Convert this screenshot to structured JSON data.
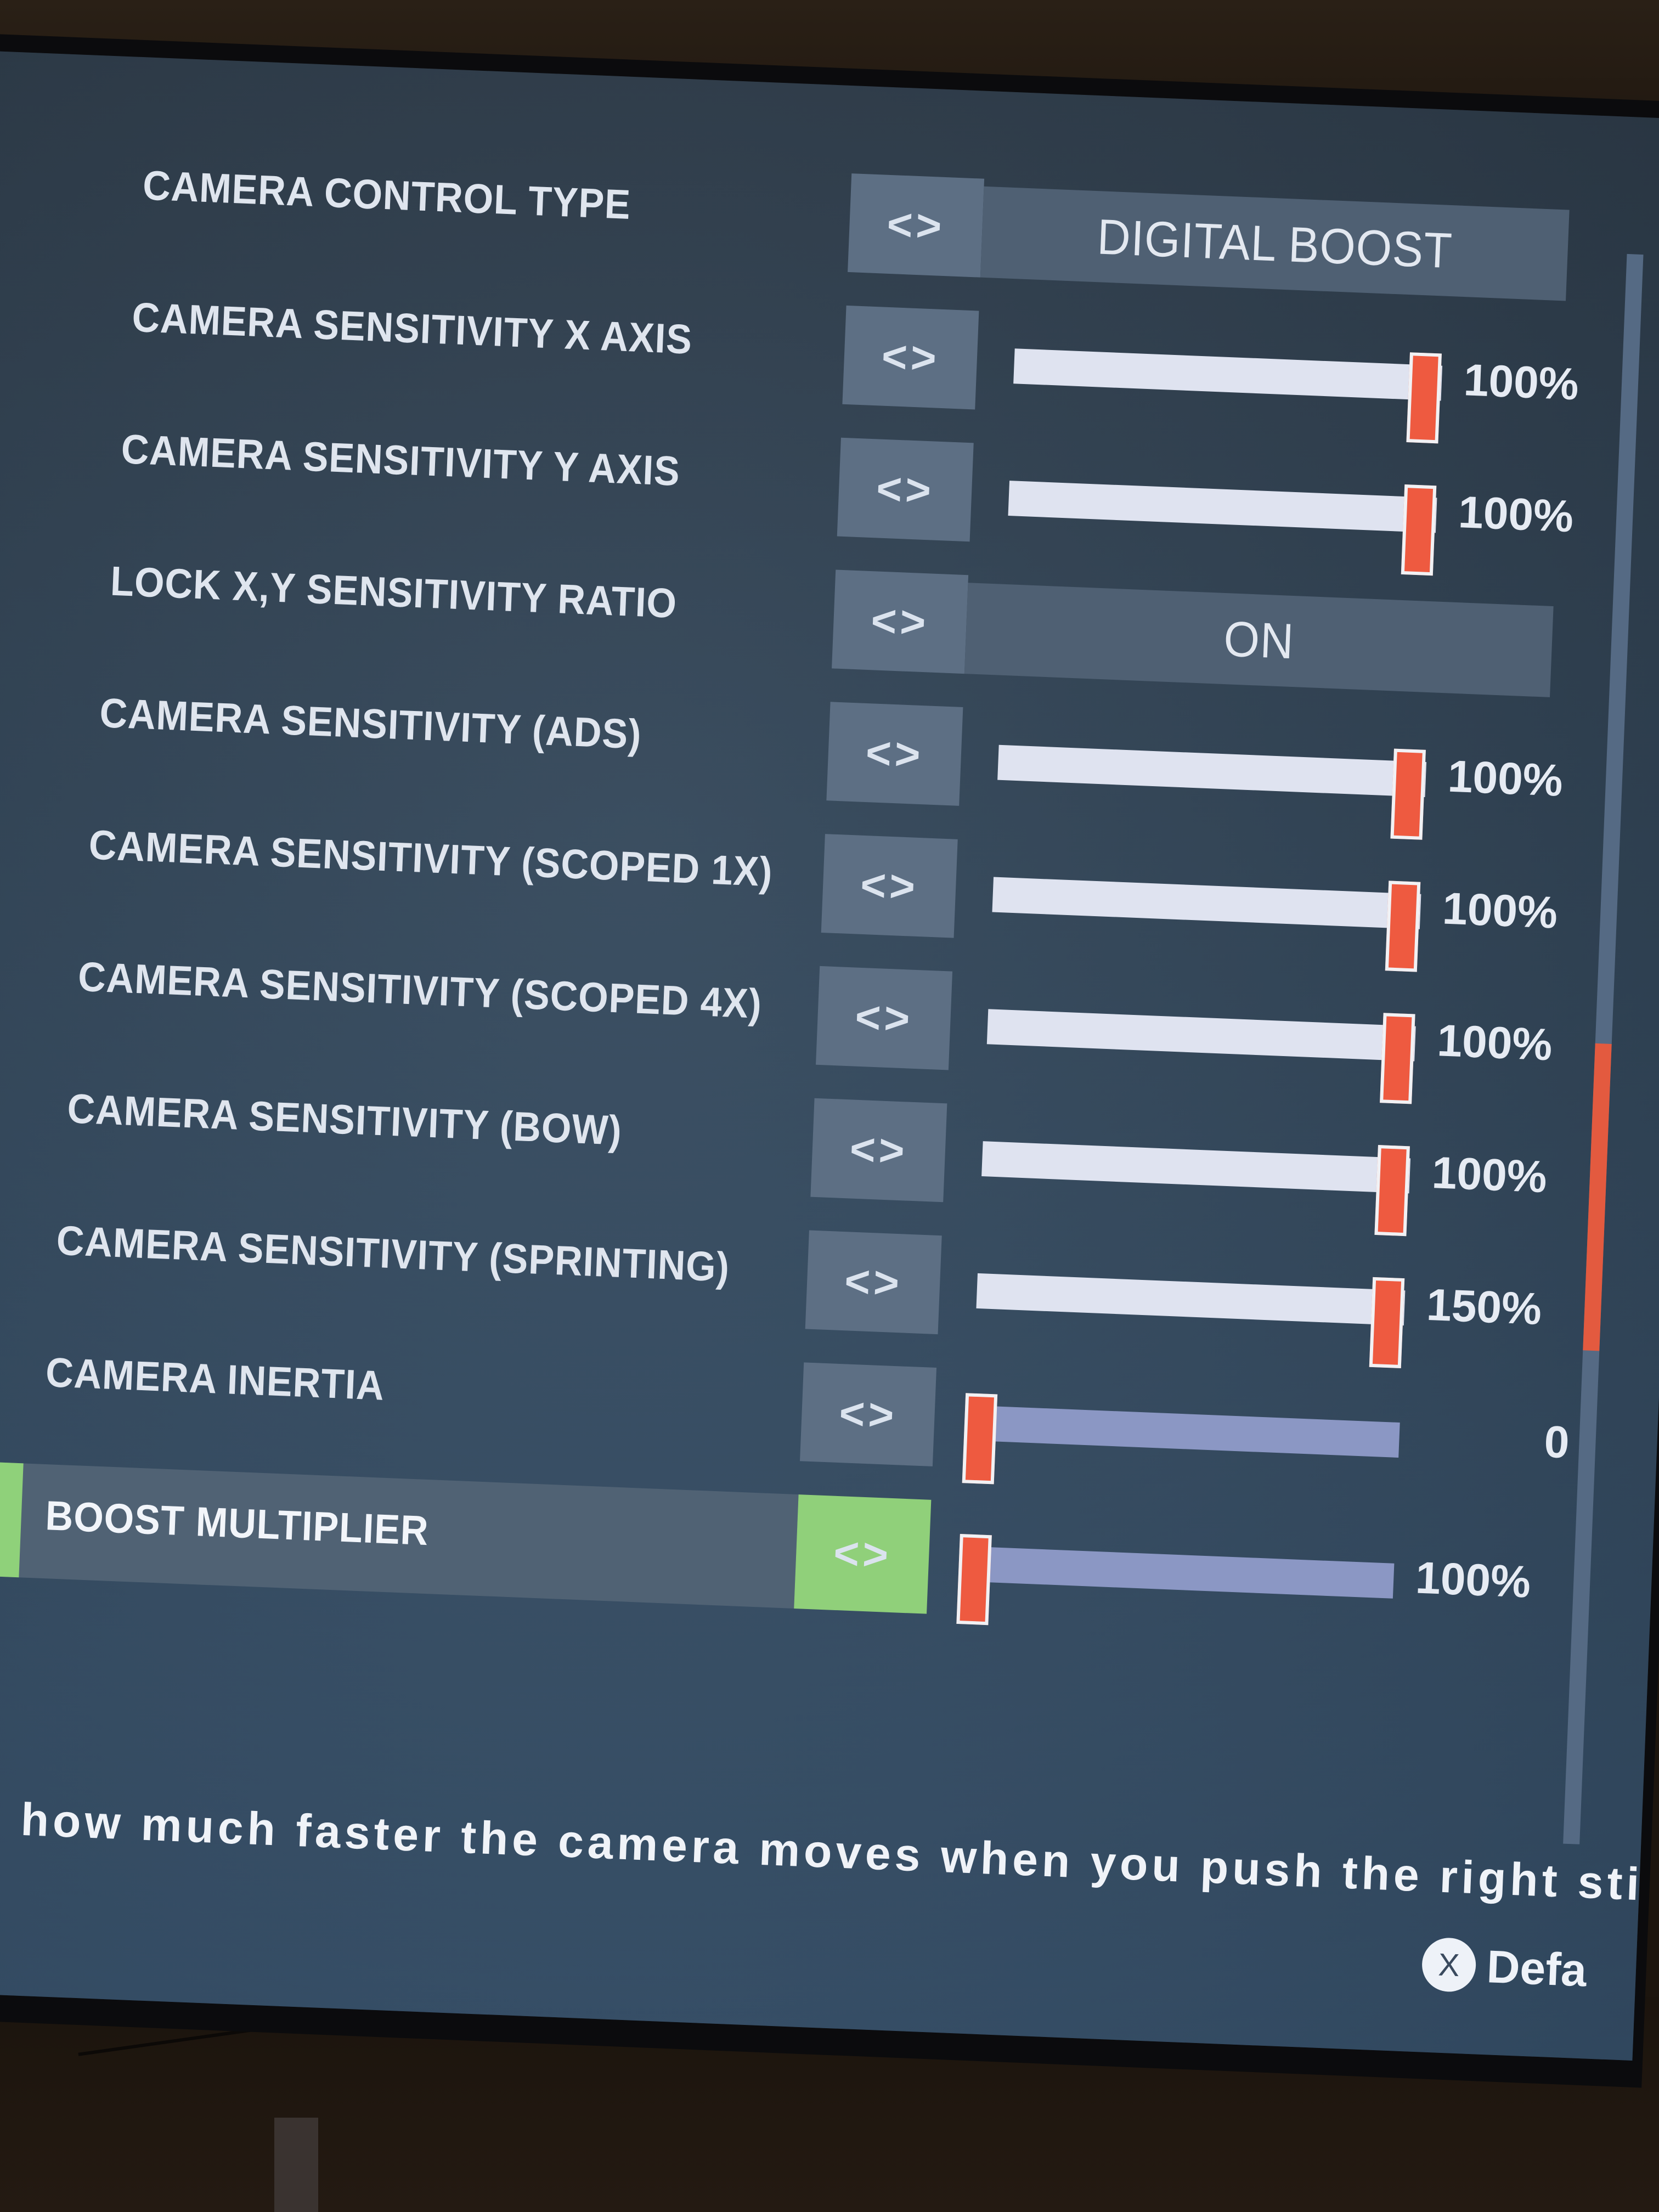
{
  "settings": [
    {
      "label": "CAMERA CONTROL TYPE",
      "type": "option",
      "value": "DIGITAL BOOST",
      "indent": 310
    },
    {
      "label": "CAMERA SENSITIVITY X AXIS",
      "type": "slider",
      "value_text": "100%",
      "level": 0.96,
      "indent": 300
    },
    {
      "label": "CAMERA SENSITIVITY Y AXIS",
      "type": "slider",
      "value_text": "100%",
      "level": 0.96,
      "indent": 290
    },
    {
      "label": "LOCK X,Y SENSITIVITY RATIO",
      "type": "option",
      "value": "ON",
      "indent": 280
    },
    {
      "label": "CAMERA SENSITIVITY (ADS)",
      "type": "slider",
      "value_text": "100%",
      "level": 0.96,
      "indent": 270
    },
    {
      "label": "CAMERA SENSITIVITY (SCOPED 1X)",
      "type": "slider",
      "value_text": "100%",
      "level": 0.96,
      "indent": 260
    },
    {
      "label": "CAMERA SENSITIVITY (SCOPED 4X)",
      "type": "slider",
      "value_text": "100%",
      "level": 0.96,
      "indent": 250
    },
    {
      "label": "CAMERA SENSITIVITY (BOW)",
      "type": "slider",
      "value_text": "100%",
      "level": 0.96,
      "indent": 240
    },
    {
      "label": "CAMERA SENSITIVITY (SPRINTING)",
      "type": "slider",
      "value_text": "150%",
      "level": 0.96,
      "indent": 230
    },
    {
      "label": "CAMERA INERTIA",
      "type": "slider",
      "value_text": "0",
      "level": 0.02,
      "dim": true,
      "indent": 220
    },
    {
      "label": "BOOST MULTIPLIER",
      "type": "slider",
      "value_text": "100%",
      "level": 0.02,
      "dim": true,
      "selected": true,
      "indent": 230
    }
  ],
  "arrow_glyph": "<>",
  "description": "ust how much faster the camera moves when you push the right stick fully left/ri",
  "footer": {
    "button_glyph": "X",
    "label": "Defa"
  },
  "colors": {
    "accent_handle": "#ee5a40",
    "selected_green": "#8fd17a",
    "panel": "#5d6f84"
  }
}
